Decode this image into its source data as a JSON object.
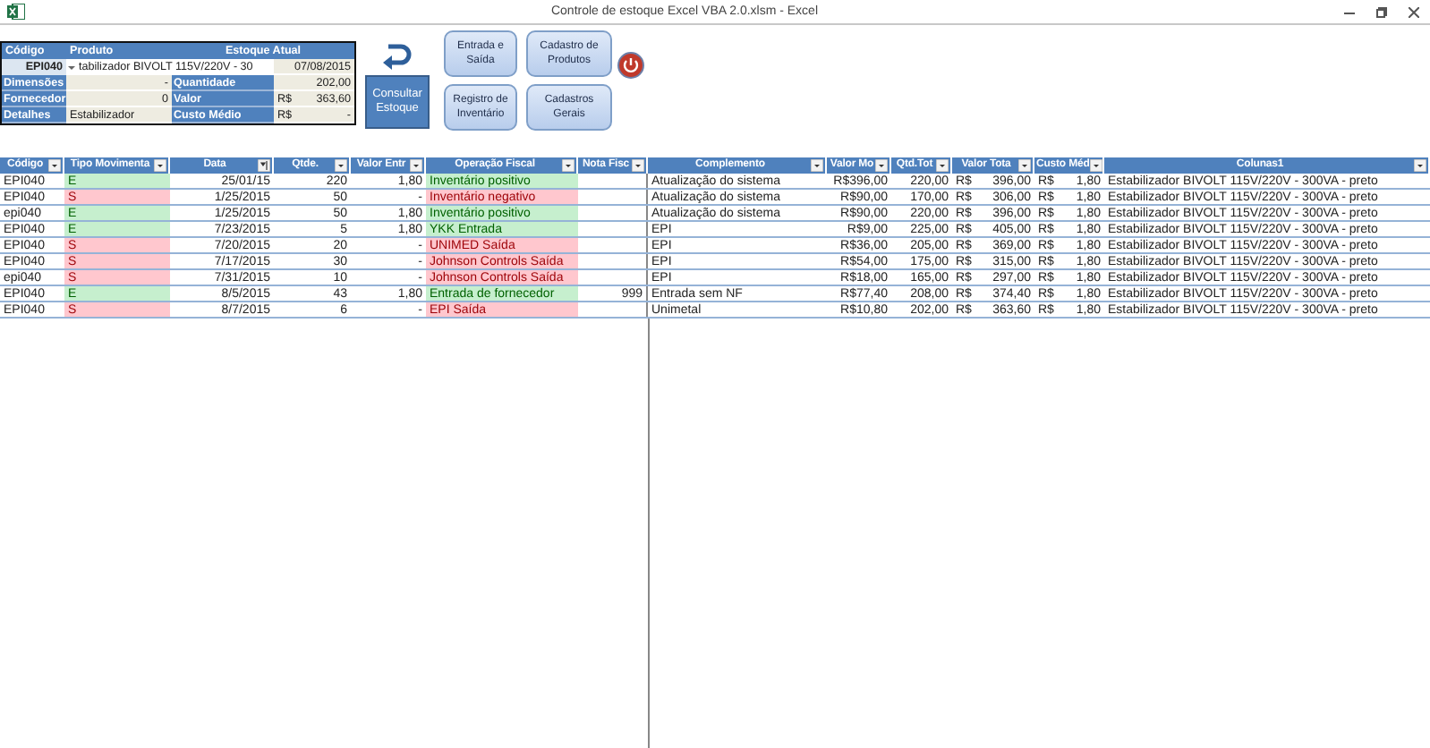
{
  "window": {
    "title": "Controle de estoque Excel VBA 2.0.xlsm  -  Excel"
  },
  "form": {
    "header": [
      "Código",
      "Produto",
      "Estoque Atual"
    ],
    "code": "EPI040",
    "product": "tabilizador BIVOLT 115V/220V - 30",
    "date": "07/08/2015",
    "fields": [
      {
        "label": "Dimensões",
        "value": "-",
        "label2": "Quantidade",
        "value2": "202,00"
      },
      {
        "label": "Fornecedor",
        "value": "0",
        "label2": "Valor",
        "currency": "R$",
        "value2": "363,60"
      },
      {
        "label": "Detalhes",
        "value": "Estabilizador",
        "label2": "Custo Médio",
        "currency": "R$",
        "value2": "-"
      }
    ]
  },
  "consult_button": "Consultar Estoque",
  "menu_buttons": [
    "Entrada e Saída",
    "Cadastro de Produtos",
    "Registro de Inventário",
    "Cadastros Gerais"
  ],
  "table": {
    "columns": [
      {
        "label": "Código",
        "sorted": false
      },
      {
        "label": "Tipo Movimenta",
        "sorted": false
      },
      {
        "label": "Data",
        "sorted": true
      },
      {
        "label": "Qtde.",
        "sorted": false
      },
      {
        "label": "Valor Entr",
        "sorted": false
      },
      {
        "label": "Operação Fiscal",
        "sorted": false
      },
      {
        "label": "Nota Fisc",
        "sorted": false
      },
      {
        "label": "Complemento",
        "sorted": false
      },
      {
        "label": "Valor Mo",
        "sorted": false
      },
      {
        "label": "Qtd.Tot",
        "sorted": false
      },
      {
        "label": "Valor Tota",
        "sorted": false
      },
      {
        "label": "Custo Méd",
        "sorted": false
      },
      {
        "label": "Colunas1",
        "sorted": false
      }
    ],
    "rows": [
      {
        "kind": "in",
        "cells": [
          "EPI040",
          "E",
          "25/01/15",
          "220",
          "1,80",
          "Inventário positivo",
          "",
          "Atualização do sistema",
          "R$396,00",
          "220,00",
          {
            "currency": "R$",
            "value": "396,00"
          },
          {
            "currency": "R$",
            "value": "1,80"
          },
          "Estabilizador BIVOLT 115V/220V - 300VA - preto"
        ]
      },
      {
        "kind": "out",
        "cells": [
          "EPI040",
          "S",
          "1/25/2015",
          "50",
          "-",
          "Inventário negativo",
          "",
          "Atualização do sistema",
          "R$90,00",
          "170,00",
          {
            "currency": "R$",
            "value": "306,00"
          },
          {
            "currency": "R$",
            "value": "1,80"
          },
          "Estabilizador BIVOLT 115V/220V - 300VA - preto"
        ]
      },
      {
        "kind": "in",
        "cells": [
          "epi040",
          "E",
          "1/25/2015",
          "50",
          "1,80",
          "Inventário positivo",
          "",
          "Atualização do sistema",
          "R$90,00",
          "220,00",
          {
            "currency": "R$",
            "value": "396,00"
          },
          {
            "currency": "R$",
            "value": "1,80"
          },
          "Estabilizador BIVOLT 115V/220V - 300VA - preto"
        ]
      },
      {
        "kind": "in",
        "cells": [
          "EPI040",
          "E",
          "7/23/2015",
          "5",
          "1,80",
          "YKK Entrada",
          "",
          "EPI",
          "R$9,00",
          "225,00",
          {
            "currency": "R$",
            "value": "405,00"
          },
          {
            "currency": "R$",
            "value": "1,80"
          },
          "Estabilizador BIVOLT 115V/220V - 300VA - preto"
        ]
      },
      {
        "kind": "out",
        "cells": [
          "EPI040",
          "S",
          "7/20/2015",
          "20",
          "-",
          "UNIMED Saída",
          "",
          "EPI",
          "R$36,00",
          "205,00",
          {
            "currency": "R$",
            "value": "369,00"
          },
          {
            "currency": "R$",
            "value": "1,80"
          },
          "Estabilizador BIVOLT 115V/220V - 300VA - preto"
        ]
      },
      {
        "kind": "out",
        "cells": [
          "EPI040",
          "S",
          "7/17/2015",
          "30",
          "-",
          "Johnson Controls Saída",
          "",
          "EPI",
          "R$54,00",
          "175,00",
          {
            "currency": "R$",
            "value": "315,00"
          },
          {
            "currency": "R$",
            "value": "1,80"
          },
          "Estabilizador BIVOLT 115V/220V - 300VA - preto"
        ]
      },
      {
        "kind": "out",
        "cells": [
          "epi040",
          "S",
          "7/31/2015",
          "10",
          "-",
          "Johnson Controls Saída",
          "",
          "EPI",
          "R$18,00",
          "165,00",
          {
            "currency": "R$",
            "value": "297,00"
          },
          {
            "currency": "R$",
            "value": "1,80"
          },
          "Estabilizador BIVOLT 115V/220V - 300VA - preto"
        ]
      },
      {
        "kind": "in",
        "cells": [
          "EPI040",
          "E",
          "8/5/2015",
          "43",
          "1,80",
          "Entrada de fornecedor",
          "999",
          "Entrada sem NF",
          "R$77,40",
          "208,00",
          {
            "currency": "R$",
            "value": "374,40"
          },
          {
            "currency": "R$",
            "value": "1,80"
          },
          "Estabilizador BIVOLT 115V/220V - 300VA - preto"
        ]
      },
      {
        "kind": "out",
        "cells": [
          "EPI040",
          "S",
          "8/7/2015",
          "6",
          "-",
          "EPI Saída",
          "",
          "Unimetal",
          "R$10,80",
          "202,00",
          {
            "currency": "R$",
            "value": "363,60"
          },
          {
            "currency": "R$",
            "value": "1,80"
          },
          "Estabilizador BIVOLT 115V/220V - 300VA - preto"
        ]
      }
    ]
  }
}
